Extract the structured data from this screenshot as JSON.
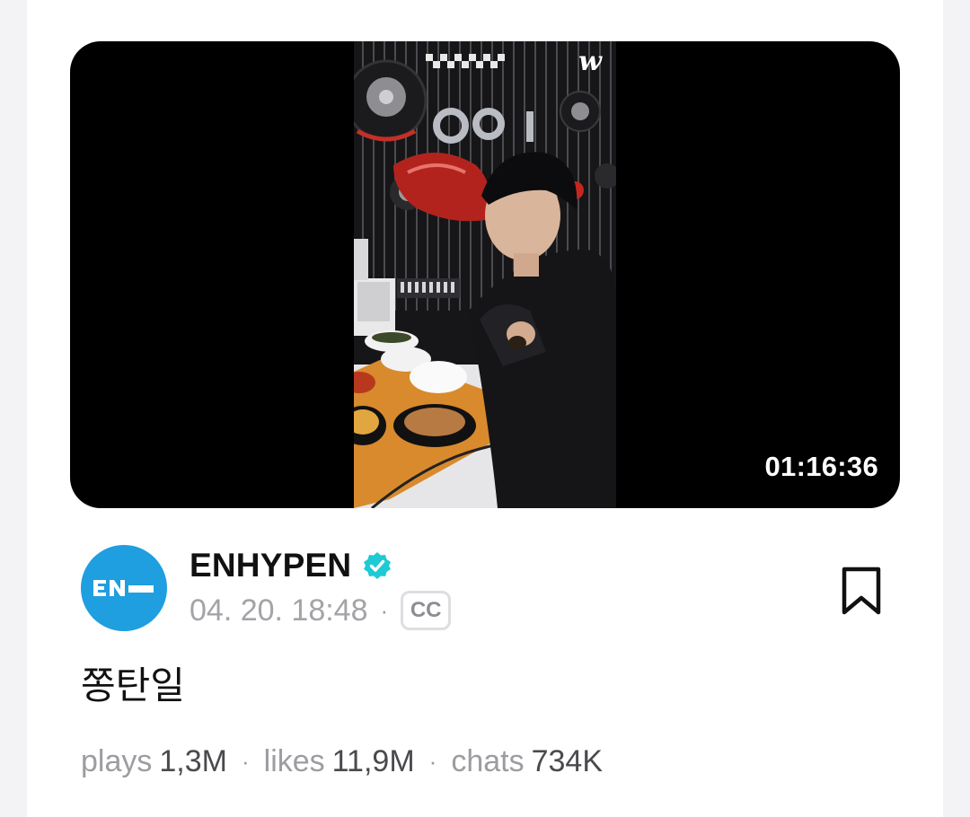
{
  "video": {
    "duration": "01:16:36",
    "watermark": "w"
  },
  "post": {
    "author": "ENHYPEN",
    "avatar_text": "EN",
    "date": "04. 20. 18:48",
    "cc_label": "CC",
    "title": "쫑탄일"
  },
  "stats": {
    "plays_label": "plays",
    "plays_value": "1,3M",
    "likes_label": "likes",
    "likes_value": "11,9M",
    "chats_label": "chats",
    "chats_value": "734K"
  },
  "icons": {
    "verified": "verified-badge-icon",
    "bookmark": "bookmark-icon",
    "closed_captions": "cc-icon"
  },
  "colors": {
    "avatar_bg": "#1f9ee0",
    "verified": "#1ecad3",
    "text_primary": "#111111",
    "text_secondary": "#a3a3a8"
  }
}
